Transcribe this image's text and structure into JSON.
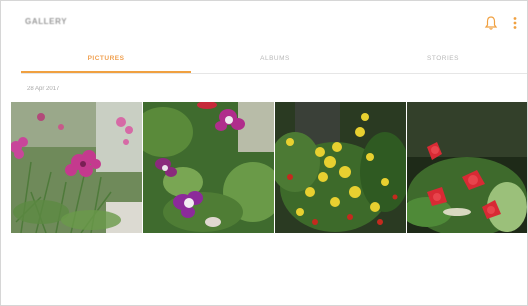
{
  "app": {
    "title": "GALLERY"
  },
  "header": {
    "notification_icon": "bell-icon",
    "more_icon": "more-vert-icon"
  },
  "tabs": [
    {
      "label": "PICTURES",
      "active": true
    },
    {
      "label": "ALBUMS",
      "active": false
    },
    {
      "label": "STORIES",
      "active": false
    }
  ],
  "section": {
    "date": "28 Apr 2017"
  },
  "photos": [
    {
      "subject": "pink-flowers"
    },
    {
      "subject": "purple-columbine"
    },
    {
      "subject": "yellow-shrub"
    },
    {
      "subject": "red-flowers"
    }
  ],
  "colors": {
    "accent": "#f0a040",
    "tab_inactive": "#b8b8b8",
    "icon": "#f0a040"
  }
}
